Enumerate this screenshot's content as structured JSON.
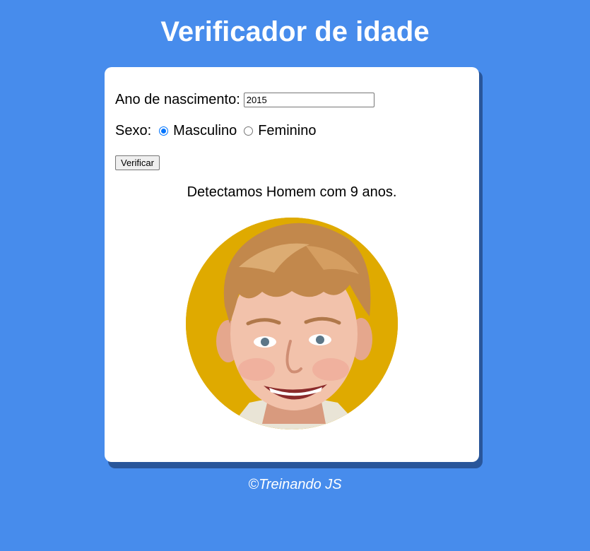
{
  "header": {
    "title": "Verificador de idade"
  },
  "form": {
    "year_label": "Ano de nascimento:",
    "year_value": "2015",
    "sex_label": "Sexo:",
    "options": [
      {
        "label": "Masculino",
        "checked": true
      },
      {
        "label": "Feminino",
        "checked": false
      }
    ],
    "button_label": "Verificar"
  },
  "result": {
    "text": "Detectamos Homem com 9 anos."
  },
  "photo": {
    "subject": "smiling blond boy",
    "background_color": "#dfaa00"
  },
  "footer": {
    "text": "©Treinando JS"
  },
  "colors": {
    "page_background": "#478cec",
    "card_shadow": "#29569a",
    "radio_accent": "#0075ff"
  }
}
